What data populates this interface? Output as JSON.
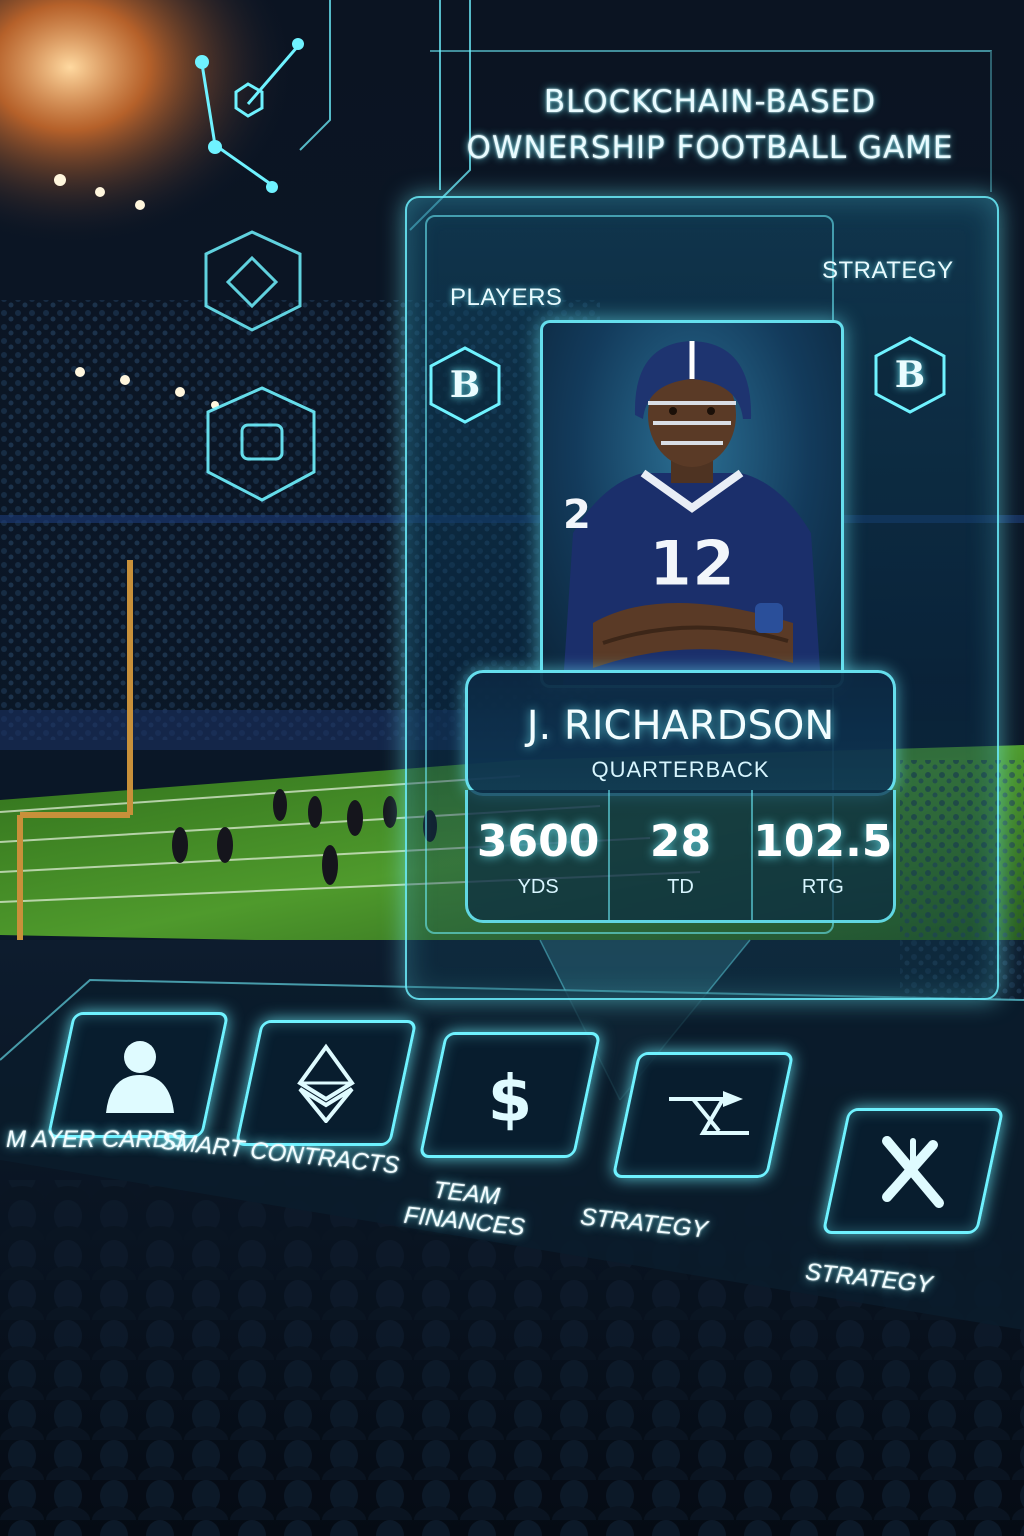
{
  "header": {
    "title_line1": "BLOCKCHAIN-BASED",
    "title_line2": "OWNERSHIP FOOTBALL GAME"
  },
  "card": {
    "left_label": "PLAYERS",
    "right_label": "STRATEGY",
    "left_badge": "B",
    "right_badge": "B",
    "jersey_number": "12",
    "player_name": "J. RICHARDSON",
    "player_position": "QUARTERBACK",
    "stats": [
      {
        "value": "3600",
        "label": "YDS"
      },
      {
        "value": "28",
        "label": "TD"
      },
      {
        "value": "102.5",
        "label": "RTG"
      }
    ]
  },
  "menu": {
    "tiles": [
      {
        "label": "M AYER CARDS",
        "icon": "person-icon"
      },
      {
        "label": "SMART CONTRACTS",
        "icon": "ethereum-icon"
      },
      {
        "label": "TEAM FINANCES",
        "label_line1": "TEAM",
        "label_line2": "FINANCES",
        "icon": "dollar-icon"
      },
      {
        "label": "STRATEGY",
        "icon": "play-diagram-icon"
      },
      {
        "label": "STRATEGY",
        "icon": "strategy-x-icon"
      }
    ]
  },
  "colors": {
    "accent": "#6ff2ff",
    "panel": "#0c3552",
    "jersey": "#1b2f6b",
    "field": "#3f8a2a"
  }
}
